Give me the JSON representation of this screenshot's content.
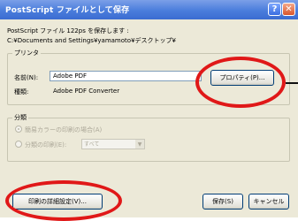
{
  "window": {
    "title": "PostScript ファイルとして保存",
    "help_glyph": "?",
    "close_glyph": "✕"
  },
  "save_message": "PostScript ファイル 122ps を保存します :",
  "save_path": "C:¥Documents and Settings¥yamamoto¥デスクトップ¥",
  "printer": {
    "group_label": "プリンタ",
    "name_label": "名前(N):",
    "name_value": "Adobe PDF",
    "type_label": "種類:",
    "type_value": "Adobe PDF Converter",
    "properties_button": "プロパティ(P)..."
  },
  "range": {
    "group_label": "分類",
    "option1": "簡易カラーの印刷の場合(A)",
    "option2": "分類の印刷(E):",
    "select_value": "すべて"
  },
  "buttons": {
    "advanced": "印刷の詳細設定(V)...",
    "save": "保存(S)",
    "cancel": "キャンセル"
  }
}
